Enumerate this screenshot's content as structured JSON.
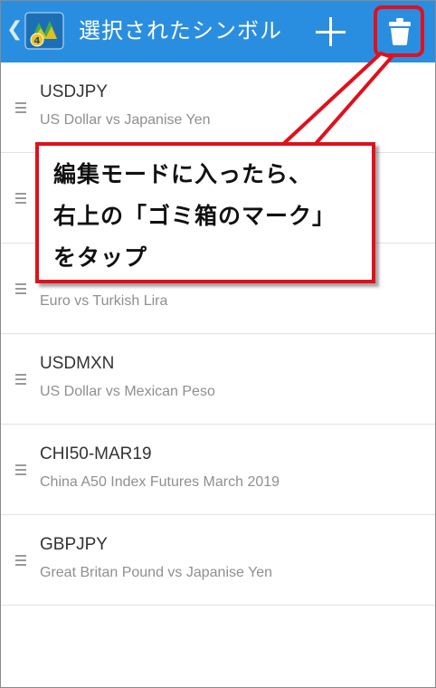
{
  "appbar": {
    "title": "選択されたシンボル",
    "back_icon": "chevron-left-icon",
    "logo_icon": "metatrader-4-logo",
    "logo_badge": "4",
    "add_icon": "plus-icon",
    "delete_icon": "trash-icon",
    "color": "#2a8ee0"
  },
  "symbols": [
    {
      "symbol": "USDJPY",
      "description": "US Dollar vs Japanise Yen"
    },
    {
      "symbol": "",
      "description": ""
    },
    {
      "symbol": "",
      "description": "Euro vs Turkish Lira"
    },
    {
      "symbol": "USDMXN",
      "description": "US Dollar vs Mexican Peso"
    },
    {
      "symbol": "CHI50-MAR19",
      "description": "China A50 Index Futures March 2019"
    },
    {
      "symbol": "GBPJPY",
      "description": "Great Britan Pound vs Japanise Yen"
    }
  ],
  "annotation": {
    "lines": [
      "編集モードに入ったら、",
      "右上の「ゴミ箱のマーク」",
      "をタップ"
    ],
    "border_color": "#e0101c"
  }
}
